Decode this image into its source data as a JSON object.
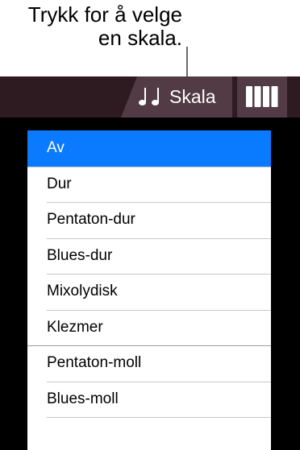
{
  "callout": {
    "line1": "Trykk for å velge",
    "line2": "en skala."
  },
  "toolbar": {
    "scale_button": {
      "label": "Skala",
      "icon": "music-notes-icon"
    },
    "keyboard_button": {
      "icon": "keyboard-icon"
    }
  },
  "menu": {
    "items": [
      {
        "label": "Av",
        "selected": true
      },
      {
        "label": "Dur"
      },
      {
        "label": "Pentaton-dur"
      },
      {
        "label": "Blues-dur"
      },
      {
        "label": "Mixolydisk"
      },
      {
        "label": "Klezmer"
      },
      {
        "label": "Pentaton-moll",
        "group_start": true
      },
      {
        "label": "Blues-moll"
      }
    ]
  },
  "colors": {
    "selected": "#0a7aff",
    "toolbar": "#2e1b22",
    "button": "#523b44"
  }
}
